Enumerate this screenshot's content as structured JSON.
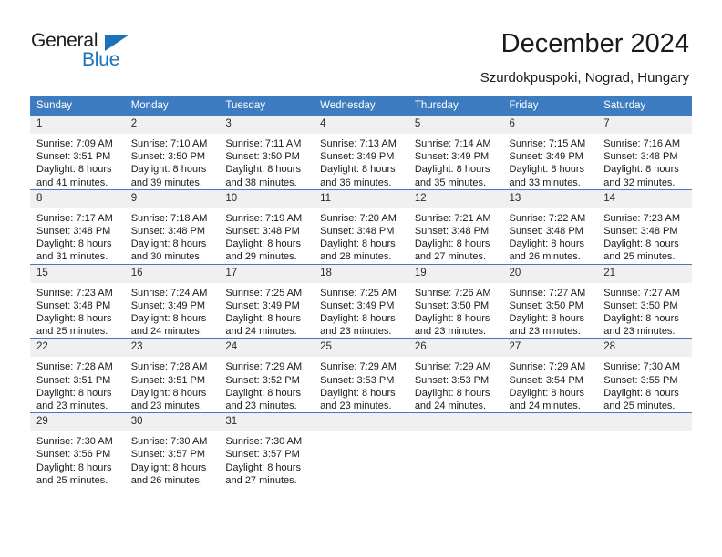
{
  "brand": {
    "name_part1": "General",
    "name_part2": "Blue",
    "accent_color": "#1a73ba"
  },
  "header": {
    "title": "December 2024",
    "subtitle": "Szurdokpuspoki, Nograd, Hungary"
  },
  "calendar": {
    "header_color": "#3d7cc0",
    "daynum_band_color": "#f0f0f0",
    "weekdays": [
      "Sunday",
      "Monday",
      "Tuesday",
      "Wednesday",
      "Thursday",
      "Friday",
      "Saturday"
    ],
    "weeks": [
      [
        {
          "day": "1",
          "sunrise": "Sunrise: 7:09 AM",
          "sunset": "Sunset: 3:51 PM",
          "daylight": "Daylight: 8 hours and 41 minutes."
        },
        {
          "day": "2",
          "sunrise": "Sunrise: 7:10 AM",
          "sunset": "Sunset: 3:50 PM",
          "daylight": "Daylight: 8 hours and 39 minutes."
        },
        {
          "day": "3",
          "sunrise": "Sunrise: 7:11 AM",
          "sunset": "Sunset: 3:50 PM",
          "daylight": "Daylight: 8 hours and 38 minutes."
        },
        {
          "day": "4",
          "sunrise": "Sunrise: 7:13 AM",
          "sunset": "Sunset: 3:49 PM",
          "daylight": "Daylight: 8 hours and 36 minutes."
        },
        {
          "day": "5",
          "sunrise": "Sunrise: 7:14 AM",
          "sunset": "Sunset: 3:49 PM",
          "daylight": "Daylight: 8 hours and 35 minutes."
        },
        {
          "day": "6",
          "sunrise": "Sunrise: 7:15 AM",
          "sunset": "Sunset: 3:49 PM",
          "daylight": "Daylight: 8 hours and 33 minutes."
        },
        {
          "day": "7",
          "sunrise": "Sunrise: 7:16 AM",
          "sunset": "Sunset: 3:48 PM",
          "daylight": "Daylight: 8 hours and 32 minutes."
        }
      ],
      [
        {
          "day": "8",
          "sunrise": "Sunrise: 7:17 AM",
          "sunset": "Sunset: 3:48 PM",
          "daylight": "Daylight: 8 hours and 31 minutes."
        },
        {
          "day": "9",
          "sunrise": "Sunrise: 7:18 AM",
          "sunset": "Sunset: 3:48 PM",
          "daylight": "Daylight: 8 hours and 30 minutes."
        },
        {
          "day": "10",
          "sunrise": "Sunrise: 7:19 AM",
          "sunset": "Sunset: 3:48 PM",
          "daylight": "Daylight: 8 hours and 29 minutes."
        },
        {
          "day": "11",
          "sunrise": "Sunrise: 7:20 AM",
          "sunset": "Sunset: 3:48 PM",
          "daylight": "Daylight: 8 hours and 28 minutes."
        },
        {
          "day": "12",
          "sunrise": "Sunrise: 7:21 AM",
          "sunset": "Sunset: 3:48 PM",
          "daylight": "Daylight: 8 hours and 27 minutes."
        },
        {
          "day": "13",
          "sunrise": "Sunrise: 7:22 AM",
          "sunset": "Sunset: 3:48 PM",
          "daylight": "Daylight: 8 hours and 26 minutes."
        },
        {
          "day": "14",
          "sunrise": "Sunrise: 7:23 AM",
          "sunset": "Sunset: 3:48 PM",
          "daylight": "Daylight: 8 hours and 25 minutes."
        }
      ],
      [
        {
          "day": "15",
          "sunrise": "Sunrise: 7:23 AM",
          "sunset": "Sunset: 3:48 PM",
          "daylight": "Daylight: 8 hours and 25 minutes."
        },
        {
          "day": "16",
          "sunrise": "Sunrise: 7:24 AM",
          "sunset": "Sunset: 3:49 PM",
          "daylight": "Daylight: 8 hours and 24 minutes."
        },
        {
          "day": "17",
          "sunrise": "Sunrise: 7:25 AM",
          "sunset": "Sunset: 3:49 PM",
          "daylight": "Daylight: 8 hours and 24 minutes."
        },
        {
          "day": "18",
          "sunrise": "Sunrise: 7:25 AM",
          "sunset": "Sunset: 3:49 PM",
          "daylight": "Daylight: 8 hours and 23 minutes."
        },
        {
          "day": "19",
          "sunrise": "Sunrise: 7:26 AM",
          "sunset": "Sunset: 3:50 PM",
          "daylight": "Daylight: 8 hours and 23 minutes."
        },
        {
          "day": "20",
          "sunrise": "Sunrise: 7:27 AM",
          "sunset": "Sunset: 3:50 PM",
          "daylight": "Daylight: 8 hours and 23 minutes."
        },
        {
          "day": "21",
          "sunrise": "Sunrise: 7:27 AM",
          "sunset": "Sunset: 3:50 PM",
          "daylight": "Daylight: 8 hours and 23 minutes."
        }
      ],
      [
        {
          "day": "22",
          "sunrise": "Sunrise: 7:28 AM",
          "sunset": "Sunset: 3:51 PM",
          "daylight": "Daylight: 8 hours and 23 minutes."
        },
        {
          "day": "23",
          "sunrise": "Sunrise: 7:28 AM",
          "sunset": "Sunset: 3:51 PM",
          "daylight": "Daylight: 8 hours and 23 minutes."
        },
        {
          "day": "24",
          "sunrise": "Sunrise: 7:29 AM",
          "sunset": "Sunset: 3:52 PM",
          "daylight": "Daylight: 8 hours and 23 minutes."
        },
        {
          "day": "25",
          "sunrise": "Sunrise: 7:29 AM",
          "sunset": "Sunset: 3:53 PM",
          "daylight": "Daylight: 8 hours and 23 minutes."
        },
        {
          "day": "26",
          "sunrise": "Sunrise: 7:29 AM",
          "sunset": "Sunset: 3:53 PM",
          "daylight": "Daylight: 8 hours and 24 minutes."
        },
        {
          "day": "27",
          "sunrise": "Sunrise: 7:29 AM",
          "sunset": "Sunset: 3:54 PM",
          "daylight": "Daylight: 8 hours and 24 minutes."
        },
        {
          "day": "28",
          "sunrise": "Sunrise: 7:30 AM",
          "sunset": "Sunset: 3:55 PM",
          "daylight": "Daylight: 8 hours and 25 minutes."
        }
      ],
      [
        {
          "day": "29",
          "sunrise": "Sunrise: 7:30 AM",
          "sunset": "Sunset: 3:56 PM",
          "daylight": "Daylight: 8 hours and 25 minutes."
        },
        {
          "day": "30",
          "sunrise": "Sunrise: 7:30 AM",
          "sunset": "Sunset: 3:57 PM",
          "daylight": "Daylight: 8 hours and 26 minutes."
        },
        {
          "day": "31",
          "sunrise": "Sunrise: 7:30 AM",
          "sunset": "Sunset: 3:57 PM",
          "daylight": "Daylight: 8 hours and 27 minutes."
        },
        {
          "day": "",
          "sunrise": "",
          "sunset": "",
          "daylight": ""
        },
        {
          "day": "",
          "sunrise": "",
          "sunset": "",
          "daylight": ""
        },
        {
          "day": "",
          "sunrise": "",
          "sunset": "",
          "daylight": ""
        },
        {
          "day": "",
          "sunrise": "",
          "sunset": "",
          "daylight": ""
        }
      ]
    ]
  }
}
